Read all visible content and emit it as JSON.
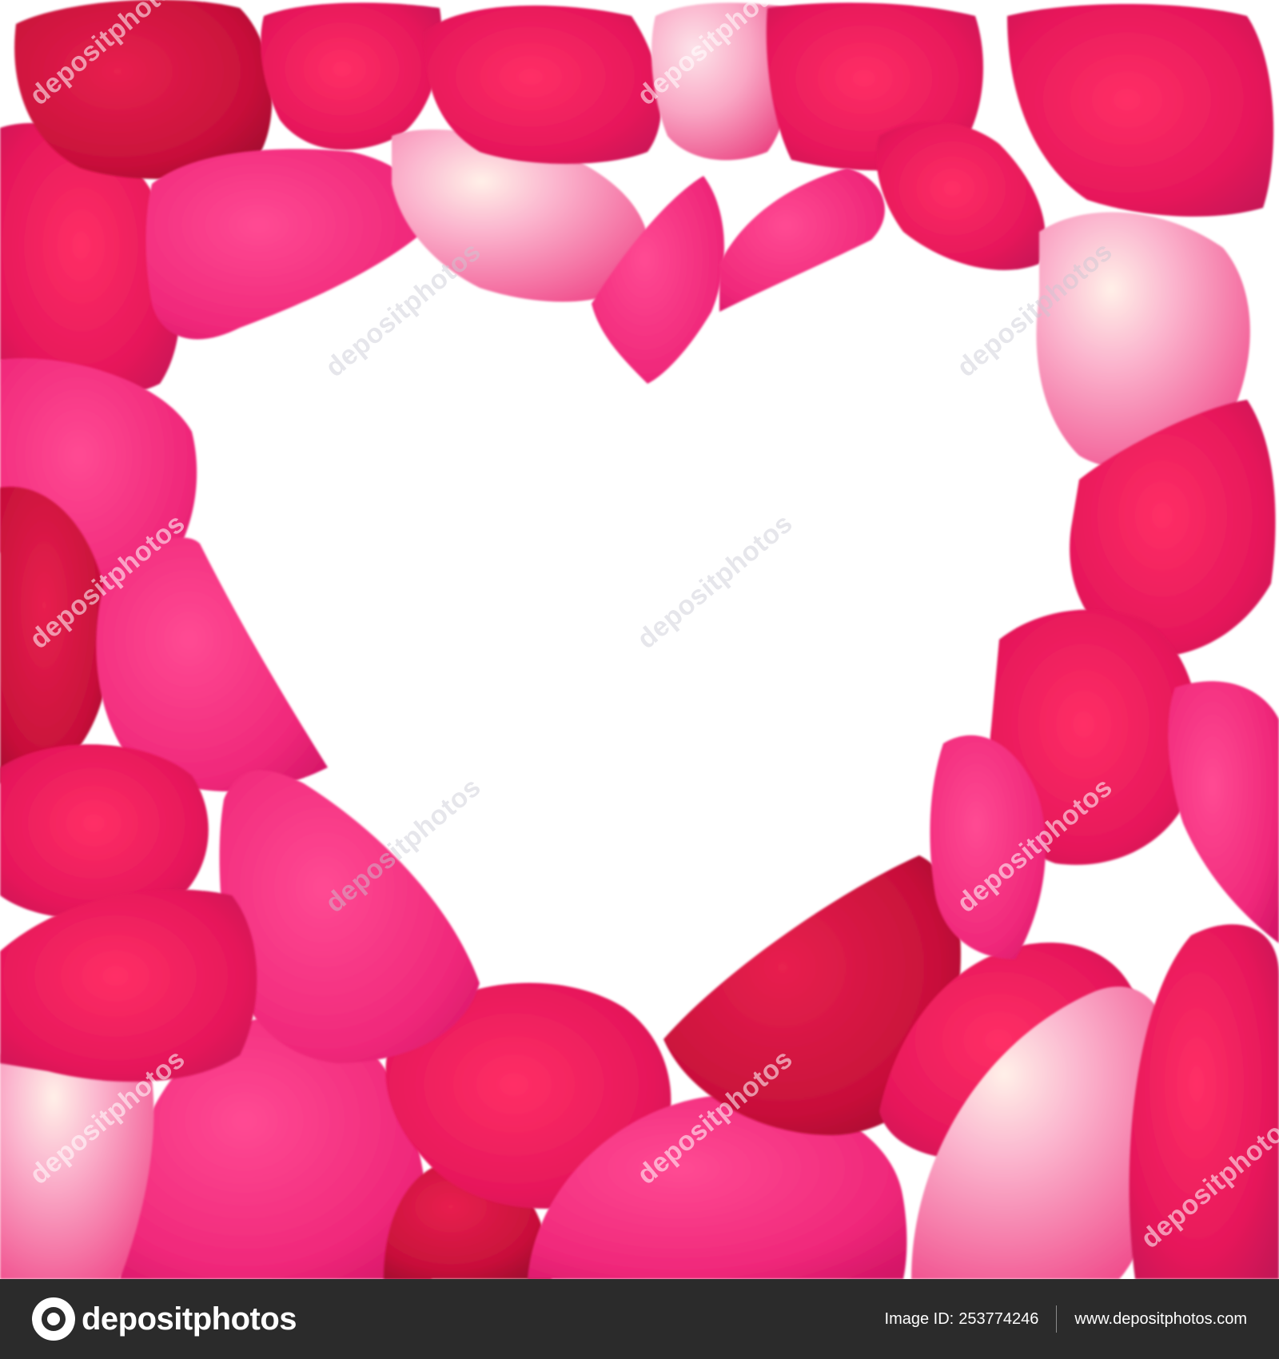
{
  "watermark": {
    "text": "depositphotos"
  },
  "footer": {
    "brand": "depositphotos",
    "image_id_label": "Image ID:",
    "image_id": "253774246",
    "site": "www.depositphotos.com"
  },
  "colors": {
    "petal_deep": "#c8103a",
    "petal_main": "#e6175a",
    "petal_hot": "#f0287a",
    "petal_light": "#f89ac0",
    "background": "#ffffff",
    "footer_bg": "#2b2b2b"
  }
}
